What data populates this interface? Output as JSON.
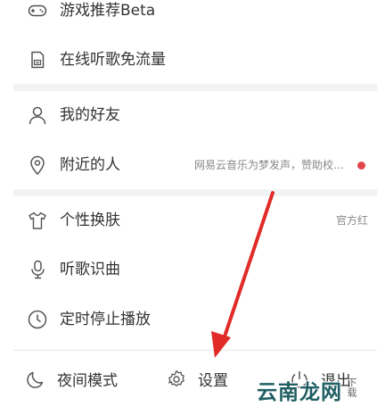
{
  "menu": {
    "game": {
      "label": "游戏推荐Beta",
      "icon": "gamepad-icon"
    },
    "free_flow": {
      "label": "在线听歌免流量",
      "icon": "sim-card-icon"
    },
    "friends": {
      "label": "我的好友",
      "icon": "person-icon"
    },
    "nearby": {
      "label": "附近的人",
      "icon": "location-pin-icon",
      "note": "网易云音乐为梦发声，赞助校…"
    },
    "skin": {
      "label": "个性换肤",
      "icon": "tshirt-icon",
      "note": "官方红"
    },
    "recognize": {
      "label": "听歌识曲",
      "icon": "microphone-icon"
    },
    "timer": {
      "label": "定时停止播放",
      "icon": "clock-icon"
    }
  },
  "bottom_bar": {
    "night": {
      "label": "夜间模式",
      "icon": "moon-icon"
    },
    "settings": {
      "label": "设置",
      "icon": "gear-icon"
    },
    "exit": {
      "label": "退出",
      "icon": "power-icon"
    }
  },
  "watermark": {
    "text": "云南龙网",
    "sub": "下载"
  },
  "colors": {
    "accent_red": "#e0474b",
    "arrow": "#e02b27",
    "watermark": "#1f5f63"
  }
}
